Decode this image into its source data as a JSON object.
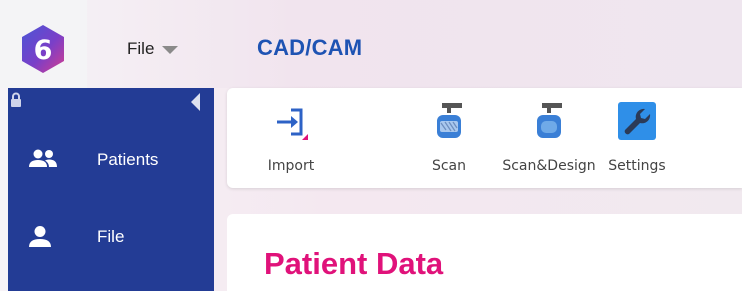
{
  "header": {
    "file_menu_label": "File",
    "app_title": "CAD/CAM",
    "logo_glyph": "6"
  },
  "sidebar": {
    "items": [
      {
        "label": "Patients",
        "icon": "people-icon"
      },
      {
        "label": "File",
        "icon": "person-icon"
      }
    ]
  },
  "toolbar": {
    "items": [
      {
        "label": "Import",
        "icon": "import-icon"
      },
      {
        "label": "Scan",
        "icon": "scan-icon"
      },
      {
        "label": "Scan&Design",
        "icon": "scan-design-icon"
      },
      {
        "label": "Settings",
        "icon": "wrench-icon"
      }
    ]
  },
  "main": {
    "title": "Patient Data"
  },
  "colors": {
    "sidebar_bg": "#233c95",
    "accent_blue": "#1e53b3",
    "title_pink": "#e0127a",
    "settings_active": "#2f8fe8"
  }
}
